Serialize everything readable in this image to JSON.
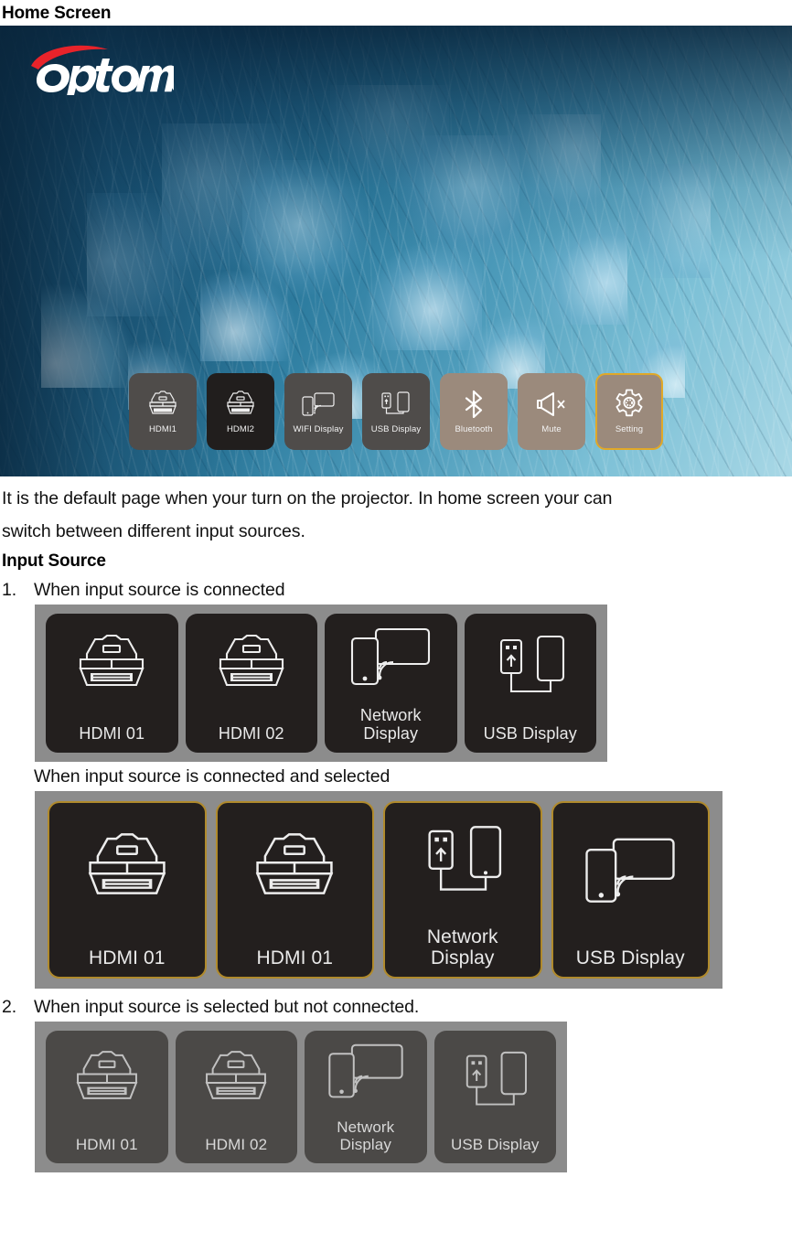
{
  "document": {
    "title": "Home Screen",
    "paragraph_line_1": "It is the default page when your turn on the projector. In home screen your can",
    "paragraph_line_2": "switch between different input sources.",
    "section_heading": "Input Source",
    "item_1_number": "1.",
    "item_1_text": "When input source is connected",
    "item_1_sub_text": "When input source is connected and selected",
    "item_2_number": "2.",
    "item_2_text": "When input source is selected but not connected."
  },
  "home_screen": {
    "brand_logo": "optoma-logo",
    "background": "water-droplets-photo",
    "accent_selected": "#e0a828",
    "tile_dark": "#4f4c4a",
    "tile_black": "#211e1d",
    "tile_tan": "#9b8a7c",
    "toolbar": [
      {
        "label": "HDMI1",
        "icon": "hdmi-connector-icon",
        "state": "normal"
      },
      {
        "label": "HDMI2",
        "icon": "hdmi-connector-icon",
        "state": "active"
      },
      {
        "label": "WIFI Display",
        "icon": "cast-screen-icon",
        "state": "normal"
      },
      {
        "label": "USB Display",
        "icon": "usb-phone-icon",
        "state": "normal"
      },
      {
        "label": "Bluetooth",
        "icon": "bluetooth-icon",
        "state": "tan"
      },
      {
        "label": "Mute",
        "icon": "speaker-mute-icon",
        "state": "tan"
      },
      {
        "label": "Setting",
        "icon": "gear-icon",
        "state": "selected"
      }
    ]
  },
  "panels": {
    "connected": {
      "caption_ref": "item_1_text",
      "background": "#8c8c8c",
      "cards": [
        {
          "label": "HDMI 01",
          "icon": "hdmi-connector-icon",
          "style": "black"
        },
        {
          "label": "HDMI 02",
          "icon": "hdmi-connector-icon",
          "style": "black"
        },
        {
          "label": "Network\nDisplay",
          "icon": "cast-screen-icon",
          "style": "black"
        },
        {
          "label": "USB Display",
          "icon": "usb-phone-icon",
          "style": "black"
        }
      ]
    },
    "connected_selected": {
      "caption_ref": "item_1_sub_text",
      "background": "#8c8c8c",
      "border_color": "#b08a2c",
      "cards": [
        {
          "label": "HDMI 01",
          "icon": "hdmi-connector-icon",
          "style": "black-selected"
        },
        {
          "label": "HDMI 01",
          "icon": "hdmi-connector-icon",
          "style": "black-selected"
        },
        {
          "label": "Network\nDisplay",
          "icon": "usb-phone-icon",
          "style": "black-selected"
        },
        {
          "label": "USB Display",
          "icon": "cast-screen-icon",
          "style": "black-selected"
        }
      ]
    },
    "not_connected": {
      "caption_ref": "item_2_text",
      "background": "#8c8c8c",
      "cards": [
        {
          "label": "HDMI 01",
          "icon": "hdmi-connector-icon",
          "style": "gray"
        },
        {
          "label": "HDMI 02",
          "icon": "hdmi-connector-icon",
          "style": "gray"
        },
        {
          "label": "Network\nDisplay",
          "icon": "cast-screen-icon",
          "style": "gray"
        },
        {
          "label": "USB Display",
          "icon": "usb-phone-icon",
          "style": "gray"
        }
      ]
    }
  }
}
